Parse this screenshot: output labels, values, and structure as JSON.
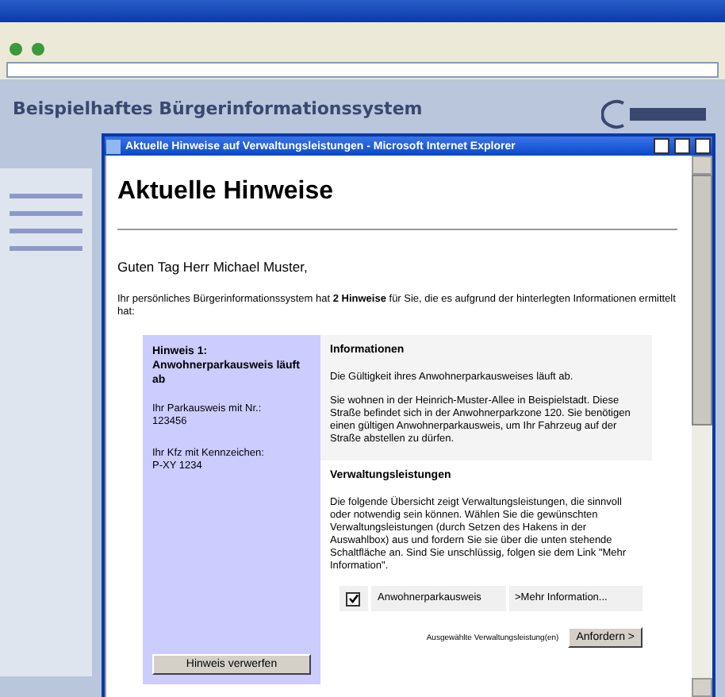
{
  "background_window": {
    "page_title": "Beispielhaftes Bürgerinformationssystem"
  },
  "dialog": {
    "title": "Aktuelle Hinweise auf Verwaltungsleistungen - Microsoft Internet Explorer",
    "heading": "Aktuelle Hinweise",
    "greeting": "Guten Tag Herr Michael Muster,",
    "intro": "Ihr persönliches Bürgerinformationssystem hat **2 Hinweise** für Sie, die es aufgrund der hinterlegten Informationen ermittelt hat:",
    "hint": {
      "title": "Hinweis 1: Anwohnerparkausweis läuft ab",
      "details": [
        {
          "label": "Ihr Parkausweis mit Nr.:",
          "value": "123456"
        },
        {
          "label": "Ihr Kfz mit Kennzeichen:",
          "value": "P-XY 1234"
        }
      ],
      "dismiss_button": "Hinweis verwerfen"
    },
    "information": {
      "heading": "Informationen",
      "paragraphs": [
        "Die Gültigkeit ihres Anwohnerparkausweises läuft ab.",
        "Sie wohnen in der Heinrich-Muster-Allee in Beispielstadt. Diese Straße befindet sich in der Anwohnerparkzone 120. Sie benötigen einen gültigen Anwohnerparkausweis, um Ihr Fahrzeug auf der Straße abstellen zu dürfen."
      ]
    },
    "services": {
      "heading": "Verwaltungsleistungen",
      "description": "Die folgende Übersicht zeigt Verwaltungsleistungen, die sinnvoll oder notwendig sein können. Wählen Sie die gewünschten Verwaltungsleistungen (durch Setzen des Hakens in der Auswahlbox) aus und fordern Sie sie über die unten stehende Schaltfläche an. Sind Sie unschlüssig, folgen sie dem Link \"Mehr Information\".",
      "items": [
        {
          "name": "Anwohnerparkausweis",
          "checked": true,
          "link": ">Mehr Information..."
        }
      ],
      "selection_label": "Ausgewählte Verwaltungsleistung(en)",
      "request_button": "Anfordern >"
    }
  }
}
